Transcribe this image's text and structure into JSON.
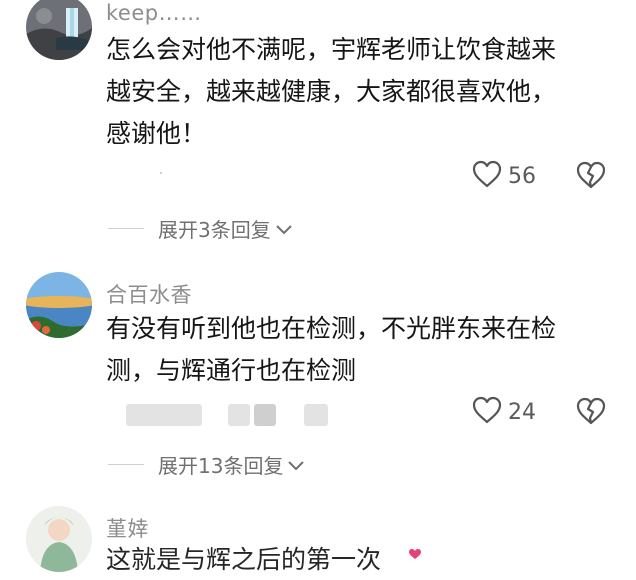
{
  "comments": [
    {
      "username": "keep……",
      "lines": [
        "怎么会对他不满呢，宇辉老师让饮食越来",
        "越安全，越来越健康，大家都很喜欢他，",
        "感谢他！"
      ],
      "likes": "56",
      "replies": "展开3条回复"
    },
    {
      "username": "合百水香",
      "lines": [
        "有没有听到他也在检测，不光胖东来在检",
        "测，与辉通行也在检测"
      ],
      "likes": "24",
      "replies": "展开13条回复"
    },
    {
      "username": "堇婞",
      "lines": [
        "这就是与辉之后的第一次"
      ]
    }
  ],
  "colors": {
    "text": "#161616",
    "meta": "#8d8d8d",
    "icon": "#555555"
  }
}
